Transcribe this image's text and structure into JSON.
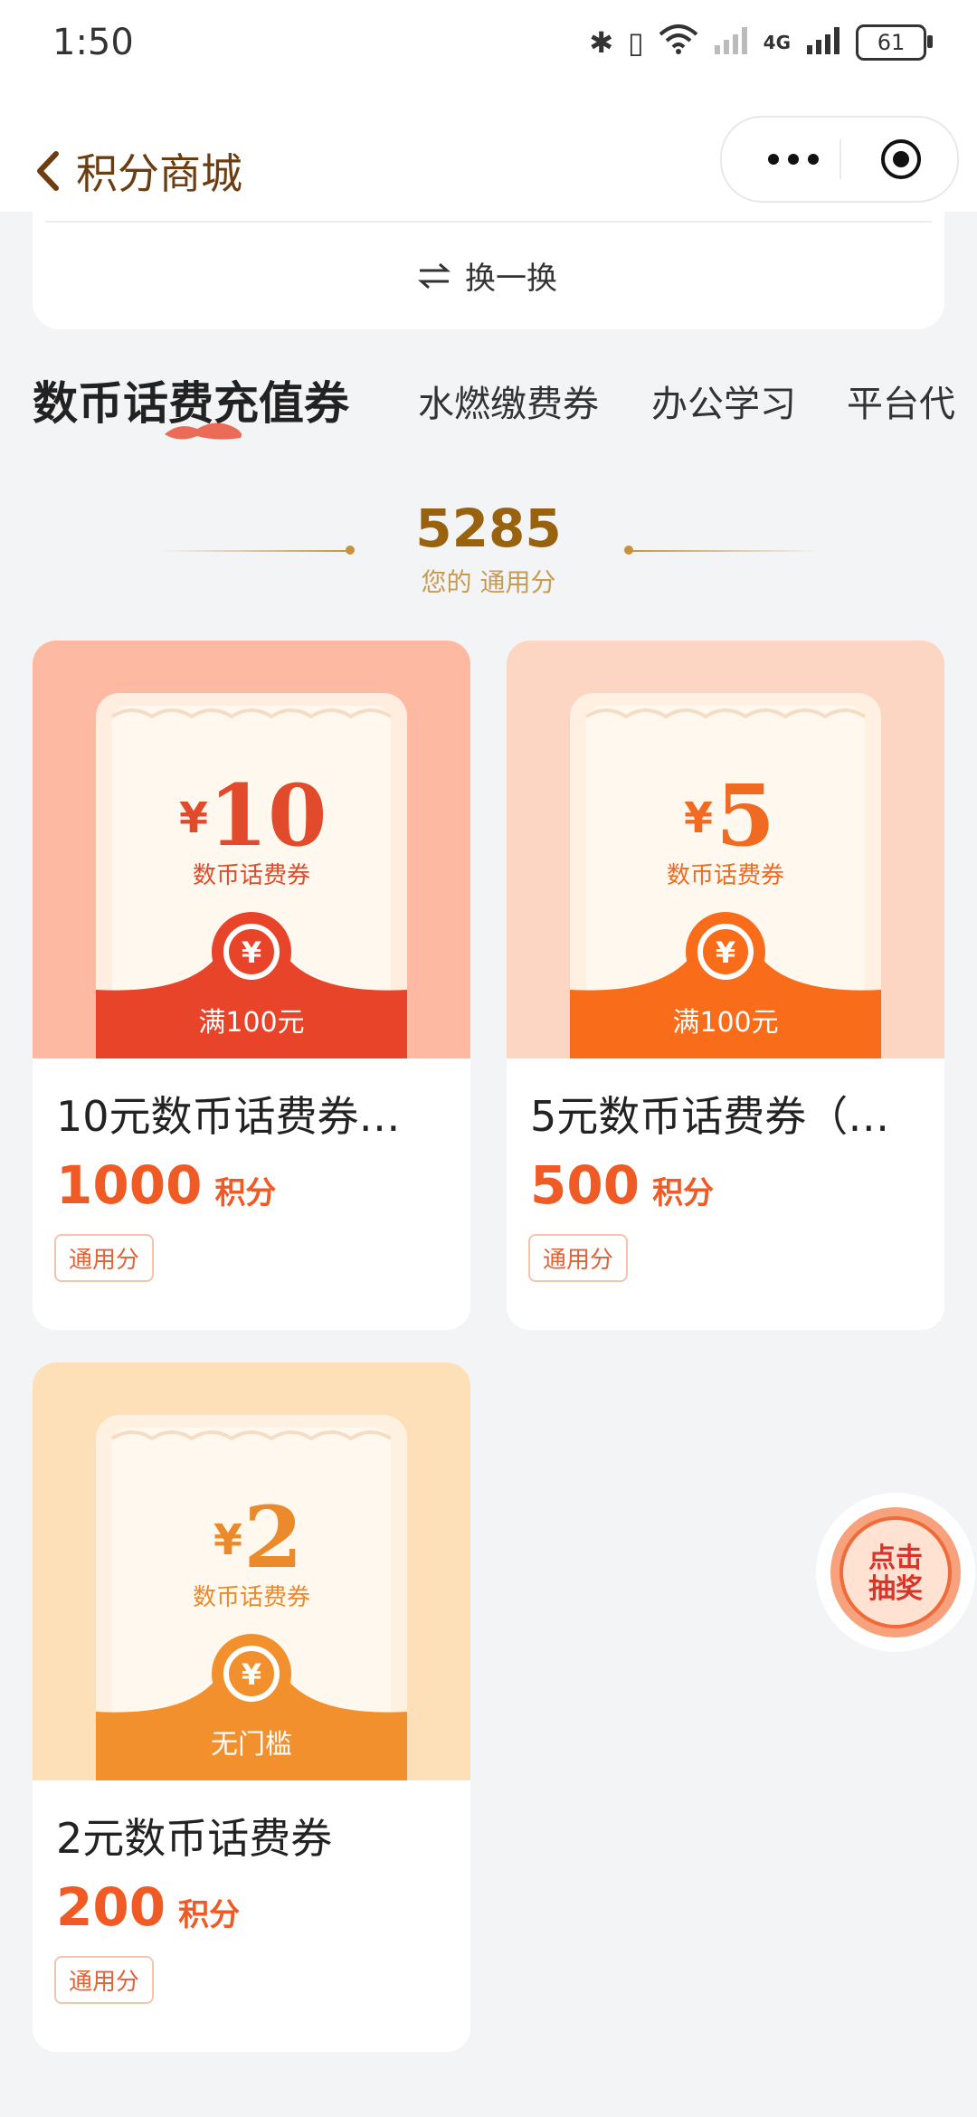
{
  "status_bar": {
    "time": "1:50",
    "battery": "61",
    "network": "4G"
  },
  "nav": {
    "title": "积分商城"
  },
  "swap": {
    "label": "换一换"
  },
  "tabs": [
    "数币话费充值券",
    "水燃缴费券",
    "办公学习",
    "平台代"
  ],
  "points": {
    "value": "5285",
    "label": "您的 通用分"
  },
  "products": [
    {
      "title": "10元数币话费券…",
      "price": "1000",
      "unit": "积分",
      "tag": "通用分",
      "ticket": {
        "currency": "¥",
        "amount": "10",
        "name": "数币话费券",
        "condition": "满100元"
      },
      "colors": {
        "bg": "#fdb9a2",
        "band": "#e8442a",
        "amount": "#e24a2c"
      }
    },
    {
      "title": "5元数币话费券（…",
      "price": "500",
      "unit": "积分",
      "tag": "通用分",
      "ticket": {
        "currency": "¥",
        "amount": "5",
        "name": "数币话费券",
        "condition": "满100元"
      },
      "colors": {
        "bg": "#fcd6c2",
        "band": "#f86c1a",
        "amount": "#f06a22"
      }
    },
    {
      "title": "2元数币话费券",
      "price": "200",
      "unit": "积分",
      "tag": "通用分",
      "ticket": {
        "currency": "¥",
        "amount": "2",
        "name": "数币话费券",
        "condition": "无门槛"
      },
      "colors": {
        "bg": "#fde0b8",
        "band": "#f1902c",
        "amount": "#eb8a2a"
      }
    }
  ],
  "lottery": {
    "line1": "点击",
    "line2": "抽奖"
  }
}
